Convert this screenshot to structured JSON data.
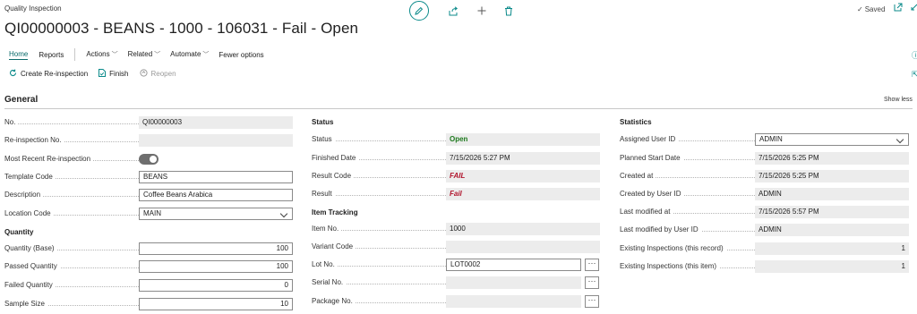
{
  "header": {
    "caption": "Quality Inspection",
    "title": "QI00000003 - BEANS - 1000 - 106031 - Fail - Open",
    "saved_label": "Saved"
  },
  "tabs": {
    "home": "Home",
    "reports": "Reports",
    "actions": "Actions",
    "related": "Related",
    "automate": "Automate",
    "fewer": "Fewer options"
  },
  "actions": {
    "create_reinspection": "Create Re-inspection",
    "finish": "Finish",
    "reopen": "Reopen"
  },
  "section": {
    "title": "General",
    "show_less": "Show less"
  },
  "general": {
    "no": {
      "label": "No.",
      "value": "QI00000003"
    },
    "reinspection_no": {
      "label": "Re-inspection No.",
      "value": ""
    },
    "most_recent": {
      "label": "Most Recent Re-inspection"
    },
    "template_code": {
      "label": "Template Code",
      "value": "BEANS"
    },
    "description": {
      "label": "Description",
      "value": "Coffee Beans Arabica"
    },
    "location_code": {
      "label": "Location Code",
      "value": "MAIN"
    }
  },
  "quantity": {
    "title": "Quantity",
    "base": {
      "label": "Quantity (Base)",
      "value": "100"
    },
    "passed": {
      "label": "Passed Quantity",
      "value": "100"
    },
    "failed": {
      "label": "Failed Quantity",
      "value": "0"
    },
    "sample": {
      "label": "Sample Size",
      "value": "10"
    }
  },
  "status": {
    "title": "Status",
    "status": {
      "label": "Status",
      "value": "Open"
    },
    "finished_date": {
      "label": "Finished Date",
      "value": "7/15/2026 5:27 PM"
    },
    "result_code": {
      "label": "Result Code",
      "value": "FAIL"
    },
    "result": {
      "label": "Result",
      "value": "Fail"
    }
  },
  "item_tracking": {
    "title": "Item Tracking",
    "item_no": {
      "label": "Item No.",
      "value": "1000"
    },
    "variant_code": {
      "label": "Variant Code",
      "value": ""
    },
    "lot_no": {
      "label": "Lot No.",
      "value": "LOT0002"
    },
    "serial_no": {
      "label": "Serial No.",
      "value": ""
    },
    "package_no": {
      "label": "Package No.",
      "value": ""
    }
  },
  "statistics": {
    "title": "Statistics",
    "assigned_user": {
      "label": "Assigned User ID",
      "value": "ADMIN"
    },
    "planned_start": {
      "label": "Planned Start Date",
      "value": "7/15/2026 5:25 PM"
    },
    "created_at": {
      "label": "Created at",
      "value": "7/15/2026 5:25 PM"
    },
    "created_by": {
      "label": "Created by User ID",
      "value": "ADMIN"
    },
    "last_modified_at": {
      "label": "Last modified at",
      "value": "7/15/2026 5:57 PM"
    },
    "last_modified_by": {
      "label": "Last modified by User ID",
      "value": "ADMIN"
    },
    "existing_record": {
      "label": "Existing Inspections (this record)",
      "value": "1"
    },
    "existing_item": {
      "label": "Existing Inspections (this item)",
      "value": "1"
    }
  },
  "ellipsis": "···",
  "colors": {
    "accent": "#0a8a8a",
    "status_open": "#1e7a1e",
    "result_fail": "#b0132b",
    "readonly_bg": "#ececec"
  }
}
